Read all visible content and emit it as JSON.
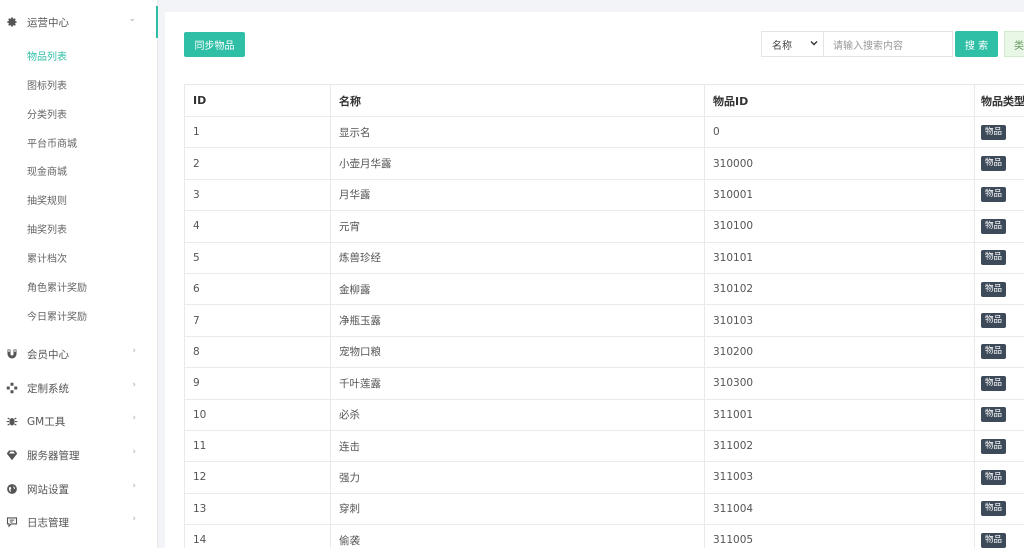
{
  "sidebar": {
    "groups": [
      {
        "label": "运营中心",
        "icon": "gear-icon",
        "expanded": true
      },
      {
        "label": "会员中心",
        "icon": "magnet-icon"
      },
      {
        "label": "定制系统",
        "icon": "puzzle-icon"
      },
      {
        "label": "GM工具",
        "icon": "bug-icon"
      },
      {
        "label": "服务器管理",
        "icon": "diamond-icon"
      },
      {
        "label": "网站设置",
        "icon": "globe-icon"
      },
      {
        "label": "日志管理",
        "icon": "comment-icon"
      }
    ],
    "sub_items": [
      {
        "label": "物品列表",
        "active": true
      },
      {
        "label": "图标列表"
      },
      {
        "label": "分类列表"
      },
      {
        "label": "平台币商城"
      },
      {
        "label": "现金商城"
      },
      {
        "label": "抽奖规则"
      },
      {
        "label": "抽奖列表"
      },
      {
        "label": "累计档次"
      },
      {
        "label": "角色累计奖励"
      },
      {
        "label": "今日累计奖励"
      }
    ],
    "accent_color": "#2fbfa6"
  },
  "toolbar": {
    "sync_label": "同步物品",
    "search_field_selected": "名称",
    "search_placeholder": "请输入搜索内容",
    "search_label": "搜 索",
    "extra_label": "类"
  },
  "table": {
    "columns": [
      "ID",
      "名称",
      "物品ID",
      "物品类型"
    ],
    "rows": [
      {
        "id": "1",
        "name": "显示名",
        "item_id": "0",
        "type": "物品"
      },
      {
        "id": "2",
        "name": "小壶月华露",
        "item_id": "310000",
        "type": "物品"
      },
      {
        "id": "3",
        "name": "月华露",
        "item_id": "310001",
        "type": "物品"
      },
      {
        "id": "4",
        "name": "元宵",
        "item_id": "310100",
        "type": "物品"
      },
      {
        "id": "5",
        "name": "炼兽珍经",
        "item_id": "310101",
        "type": "物品"
      },
      {
        "id": "6",
        "name": "金柳露",
        "item_id": "310102",
        "type": "物品"
      },
      {
        "id": "7",
        "name": "净瓶玉露",
        "item_id": "310103",
        "type": "物品"
      },
      {
        "id": "8",
        "name": "宠物口粮",
        "item_id": "310200",
        "type": "物品"
      },
      {
        "id": "9",
        "name": "千叶莲露",
        "item_id": "310300",
        "type": "物品"
      },
      {
        "id": "10",
        "name": "必杀",
        "item_id": "311001",
        "type": "物品"
      },
      {
        "id": "11",
        "name": "连击",
        "item_id": "311002",
        "type": "物品"
      },
      {
        "id": "12",
        "name": "强力",
        "item_id": "311003",
        "type": "物品"
      },
      {
        "id": "13",
        "name": "穿刺",
        "item_id": "311004",
        "type": "物品"
      },
      {
        "id": "14",
        "name": "偷袭",
        "item_id": "311005",
        "type": "物品"
      }
    ]
  }
}
